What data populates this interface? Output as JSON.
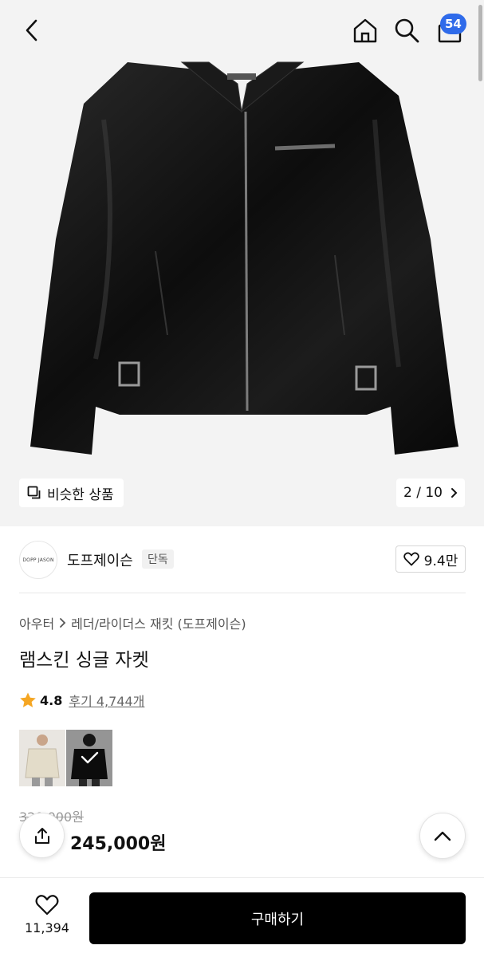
{
  "header": {
    "back_icon": "chevron-left-icon",
    "home_icon": "home-icon",
    "search_icon": "search-icon",
    "cart_icon": "shopping-bag-icon",
    "cart_count": "54"
  },
  "gallery": {
    "similar_label": "비슷한 상품",
    "page_current": "2",
    "page_total": "10",
    "page_text": "2 / 10"
  },
  "brand": {
    "logo_text": "DOPP JASON",
    "name": "도프제이슨",
    "tag": "단독",
    "likes": "9.4만"
  },
  "product": {
    "breadcrumb": [
      "아우터",
      "레더/라이더스 재킷 (도프제이슨)"
    ],
    "title": "램스킨 싱글 자켓",
    "rating": "4.8",
    "review_text": "후기 4,744개",
    "original_price": "320,000원",
    "sale_price": "245,000원"
  },
  "bottom": {
    "wish_count": "11,394",
    "buy_label": "구매하기"
  },
  "colors": {
    "accent": "#2f6bea",
    "star": "#f5a623",
    "buy_bg": "#000000"
  }
}
